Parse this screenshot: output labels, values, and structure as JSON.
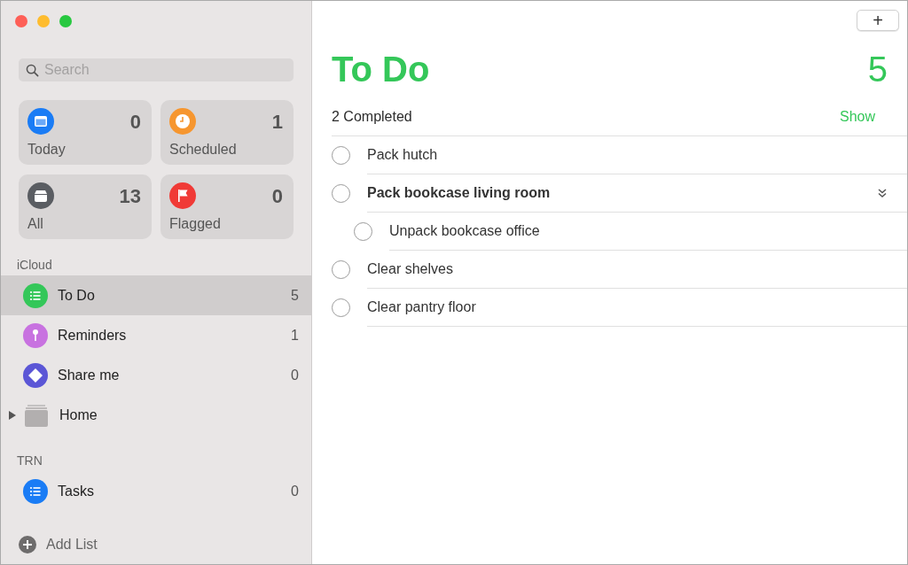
{
  "search": {
    "placeholder": "Search"
  },
  "smart_lists": [
    {
      "kind": "today",
      "label": "Today",
      "count": "0",
      "color": "#1a7cf5"
    },
    {
      "kind": "scheduled",
      "label": "Scheduled",
      "count": "1",
      "color": "#f6962f"
    },
    {
      "kind": "all",
      "label": "All",
      "count": "13",
      "color": "#5a5d62"
    },
    {
      "kind": "flagged",
      "label": "Flagged",
      "count": "0",
      "color": "#f03a36"
    }
  ],
  "sections": [
    {
      "title": "iCloud",
      "lists": [
        {
          "kind": "list",
          "name": "To Do",
          "count": "5",
          "color": "#34c759",
          "selected": true
        },
        {
          "kind": "pin",
          "name": "Reminders",
          "count": "1",
          "color": "#c872e0",
          "selected": false
        },
        {
          "kind": "diamond",
          "name": "Share me",
          "count": "0",
          "color": "#5b56d6",
          "selected": false
        },
        {
          "kind": "group",
          "name": "Home",
          "expanded": false,
          "selected": false
        }
      ]
    },
    {
      "title": "TRN",
      "lists": [
        {
          "kind": "list",
          "name": "Tasks",
          "count": "0",
          "color": "#1a7cf5",
          "selected": false
        }
      ]
    }
  ],
  "add_list": "Add List",
  "add_button": "+",
  "list": {
    "title": "To Do",
    "count": "5",
    "completed": "2 Completed",
    "show": "Show",
    "tasks": [
      {
        "title": "Pack hutch",
        "checked": false
      },
      {
        "title": "Pack bookcase living room",
        "checked": false,
        "expanded": true,
        "children": [
          {
            "title": "Unpack bookcase office",
            "checked": false
          }
        ]
      },
      {
        "title": "Clear shelves",
        "checked": false
      },
      {
        "title": "Clear pantry floor",
        "checked": false
      }
    ]
  }
}
